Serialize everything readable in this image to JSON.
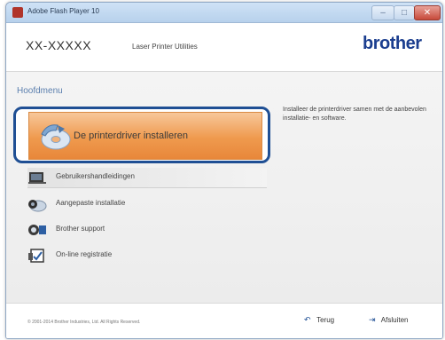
{
  "window": {
    "title": "Adobe Flash Player 10",
    "controls": {
      "minimize": "–",
      "maximize": "□",
      "close": "✕"
    }
  },
  "header": {
    "model": "XX-XXXXX",
    "utility": "Laser Printer Utilities",
    "brand": "brother"
  },
  "main": {
    "section_label": "Hoofdmenu",
    "primary": {
      "label": "De printerdriver installeren",
      "icon": "cd-disc-icon"
    },
    "description": "Installeer de printerdriver samen met de aanbevolen installatie- en software.",
    "items": [
      {
        "label": "Gebruikershandleidingen",
        "icon": "manuals-icon"
      },
      {
        "label": "Aangepaste installatie",
        "icon": "custom-install-icon"
      },
      {
        "label": "Brother support",
        "icon": "support-icon"
      },
      {
        "label": "On-line registratie",
        "icon": "online-registration-icon"
      }
    ]
  },
  "footer": {
    "copyright": "© 2001-2014 Brother Industries, Ltd. All Rights Reserved.",
    "back_label": "Terug",
    "back_icon": "back-arrow-icon",
    "exit_label": "Afsluiten",
    "exit_icon": "exit-icon"
  },
  "colors": {
    "brand": "#1b3e8f",
    "primary_button": "#ef9a4e",
    "highlight_border": "#1f4f94",
    "section_label": "#5b7fae"
  }
}
